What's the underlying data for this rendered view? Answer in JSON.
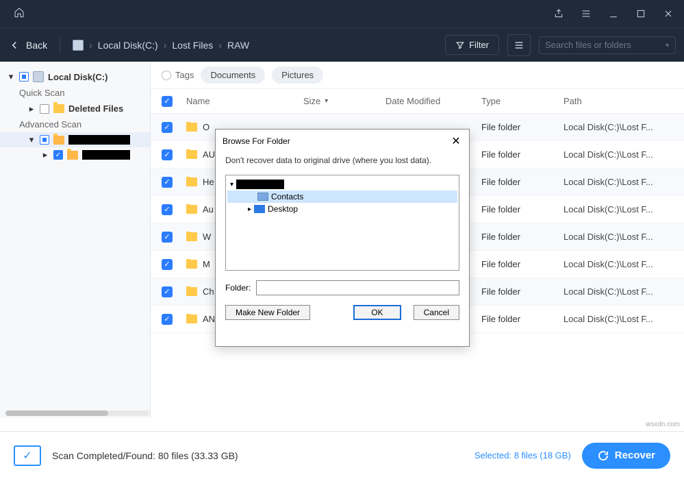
{
  "titlebar": {},
  "toolbar": {
    "back_label": "Back",
    "breadcrumbs": [
      "Local Disk(C:)",
      "Lost Files",
      "RAW"
    ],
    "filter_label": "Filter",
    "search_placeholder": "Search files or folders"
  },
  "sidebar": {
    "root_label": "Local Disk(C:)",
    "quick_scan_label": "Quick Scan",
    "deleted_files_label": "Deleted Files",
    "advanced_scan_label": "Advanced Scan"
  },
  "tagbar": {
    "tags_label": "Tags",
    "pills": [
      "Documents",
      "Pictures"
    ]
  },
  "columns": {
    "name": "Name",
    "size": "Size",
    "date": "Date Modified",
    "type": "Type",
    "path": "Path"
  },
  "rows": [
    {
      "name": "O",
      "type": "File folder",
      "path": "Local Disk(C:)\\Lost F..."
    },
    {
      "name": "AU",
      "type": "File folder",
      "path": "Local Disk(C:)\\Lost F..."
    },
    {
      "name": "He",
      "type": "File folder",
      "path": "Local Disk(C:)\\Lost F..."
    },
    {
      "name": "Au",
      "type": "File folder",
      "path": "Local Disk(C:)\\Lost F..."
    },
    {
      "name": "W",
      "type": "File folder",
      "path": "Local Disk(C:)\\Lost F..."
    },
    {
      "name": "M",
      "type": "File folder",
      "path": "Local Disk(C:)\\Lost F..."
    },
    {
      "name": "Ch",
      "type": "File folder",
      "path": "Local Disk(C:)\\Lost F..."
    },
    {
      "name": "AN",
      "type": "File folder",
      "path": "Local Disk(C:)\\Lost F..."
    }
  ],
  "dialog": {
    "title": "Browse For Folder",
    "message": "Don't recover data to original drive (where you lost data).",
    "tree": {
      "contacts_label": "Contacts",
      "desktop_label": "Desktop"
    },
    "folder_label": "Folder:",
    "folder_value": "",
    "make_new_label": "Make New Folder",
    "ok_label": "OK",
    "cancel_label": "Cancel"
  },
  "footer": {
    "status": "Scan Completed/Found: 80 files (33.33 GB)",
    "selected": "Selected: 8 files (18 GB)",
    "recover_label": "Recover"
  },
  "watermark": "wsxdn.com"
}
